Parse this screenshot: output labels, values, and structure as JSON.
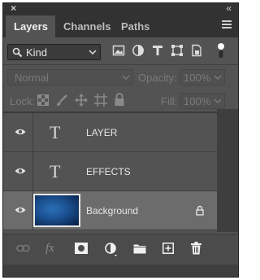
{
  "panel": {
    "tabs": [
      {
        "label": "Layers",
        "active": true
      },
      {
        "label": "Channels",
        "active": false
      },
      {
        "label": "Paths",
        "active": false
      }
    ]
  },
  "filter": {
    "kind_label": "Kind",
    "icons": [
      "image-filter-icon",
      "adjustment-filter-icon",
      "type-filter-icon",
      "shape-filter-icon",
      "smart-object-filter-icon",
      "filter-toggle-icon"
    ]
  },
  "blend": {
    "mode": "Normal",
    "opacity_label": "Opacity:",
    "opacity_value": "100%"
  },
  "lock": {
    "label": "Lock:",
    "icons": [
      "lock-transparent-icon",
      "lock-image-icon",
      "lock-position-icon",
      "lock-artboard-icon",
      "lock-all-icon"
    ],
    "fill_label": "Fill:",
    "fill_value": "100%"
  },
  "layers": [
    {
      "name": "LAYER",
      "type": "text",
      "visible": true,
      "selected": false
    },
    {
      "name": "EFFECTS",
      "type": "text",
      "visible": true,
      "selected": false
    },
    {
      "name": "Background",
      "type": "image",
      "visible": true,
      "selected": true,
      "locked": true
    }
  ],
  "bottom_icons": [
    "link-layers-icon",
    "fx-icon",
    "add-mask-icon",
    "adjustment-layer-icon",
    "folder-icon",
    "new-layer-icon",
    "trash-icon"
  ],
  "fx_label": "fx",
  "colors": {
    "panel": "#535353",
    "tabbar": "#323232",
    "selected_row": "#6c6c6c"
  }
}
